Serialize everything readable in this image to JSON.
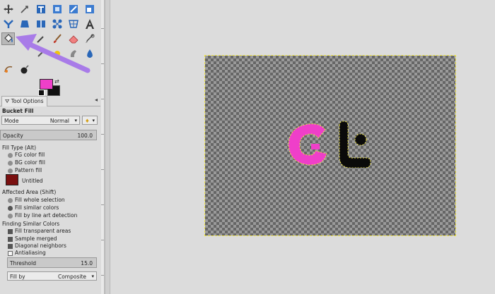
{
  "tool_options": {
    "tab_label": "Tool Options",
    "tool_name": "Bucket Fill",
    "mode_label": "Mode",
    "mode_value": "Normal",
    "opacity_label": "Opacity",
    "opacity_value": "100.0",
    "fill_type_label": "Fill Type  (Alt)",
    "fill_type_options": [
      "FG color fill",
      "BG color fill",
      "Pattern fill"
    ],
    "pattern_name": "Untitled",
    "affected_area_label": "Affected Area  (Shift)",
    "affected_area_options": [
      "Fill whole selection",
      "Fill similar colors",
      "Fill by line art detection"
    ],
    "finding_label": "Finding Similar Colors",
    "finding_options": [
      "Fill transparent areas",
      "Sample merged",
      "Diagonal neighbors",
      "Antialiasing"
    ],
    "threshold_label": "Threshold",
    "threshold_value": "15.0",
    "fill_by_label": "Fill by",
    "fill_by_value": "Composite"
  },
  "colors": {
    "foreground": "#ef3fc9",
    "background": "#111111",
    "annotation_arrow": "#a87be8",
    "selection_outline": "#f2e640"
  },
  "canvas": {
    "logo_text": "Gt"
  }
}
